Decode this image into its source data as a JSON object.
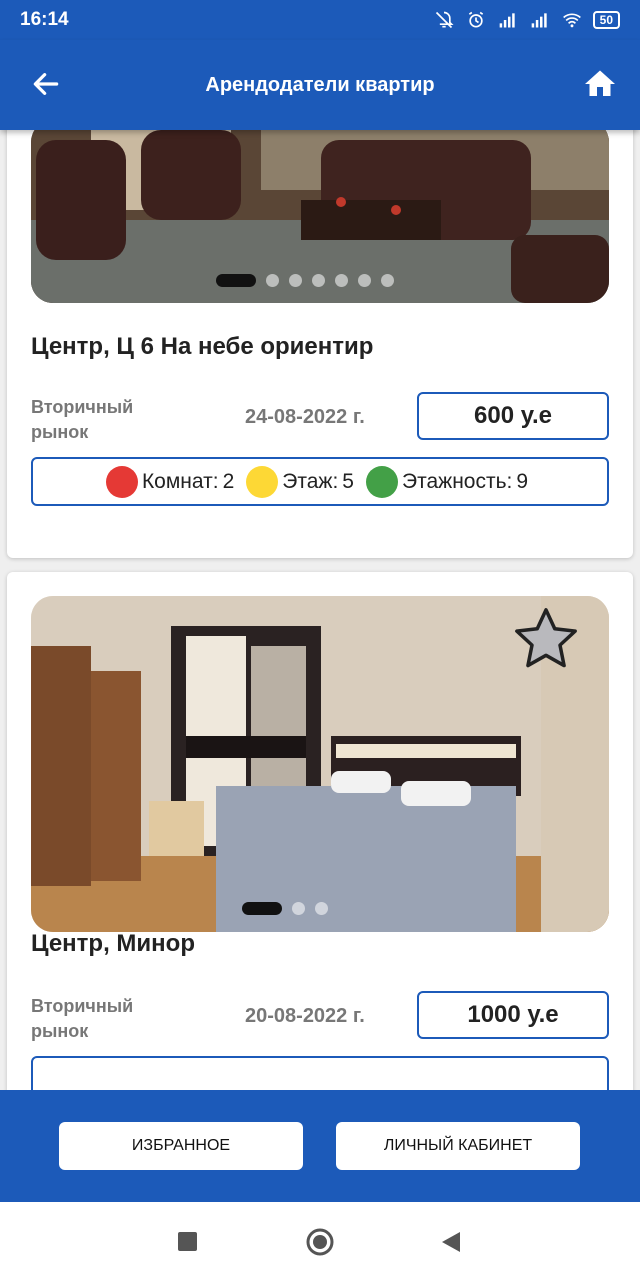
{
  "status_bar": {
    "time": "16:14",
    "battery": "50",
    "icons": [
      "alarm-off-icon",
      "alarm-icon",
      "signal-icon",
      "signal-icon",
      "wifi-icon",
      "battery-icon"
    ]
  },
  "app_bar": {
    "title": "Арендодатели квартир",
    "back_icon": "arrow-left-icon",
    "home_icon": "home-icon"
  },
  "listings": [
    {
      "title": "Центр, Ц 6 На небе ориентир",
      "market": "Вторичный рынок",
      "date": "24-08-2022 г.",
      "price": "600 у.е",
      "photo_count": 7,
      "active_photo": 1,
      "rooms_label": "Комнат:",
      "rooms": "2",
      "floor_label": "Этаж:",
      "floor": "5",
      "floors_label": "Этажность:",
      "floors": "9"
    },
    {
      "title": "Центр, Минор",
      "market": "Вторичный рынок",
      "date": "20-08-2022 г.",
      "price": "1000 у.е",
      "photo_count": 3,
      "active_photo": 1,
      "favorite_icon": "star-icon"
    }
  ],
  "colors": {
    "primary": "#1c5ab9",
    "rooms": "#e53935",
    "floor": "#fdd835",
    "floors": "#43a047"
  },
  "bottom_bar": {
    "favorites_label": "ИЗБРАННОЕ",
    "cabinet_label": "ЛИЧНЫЙ КАБИНЕТ"
  },
  "nav_bar": {
    "icons": [
      "recents-icon",
      "home-circle-icon",
      "back-triangle-icon"
    ]
  }
}
